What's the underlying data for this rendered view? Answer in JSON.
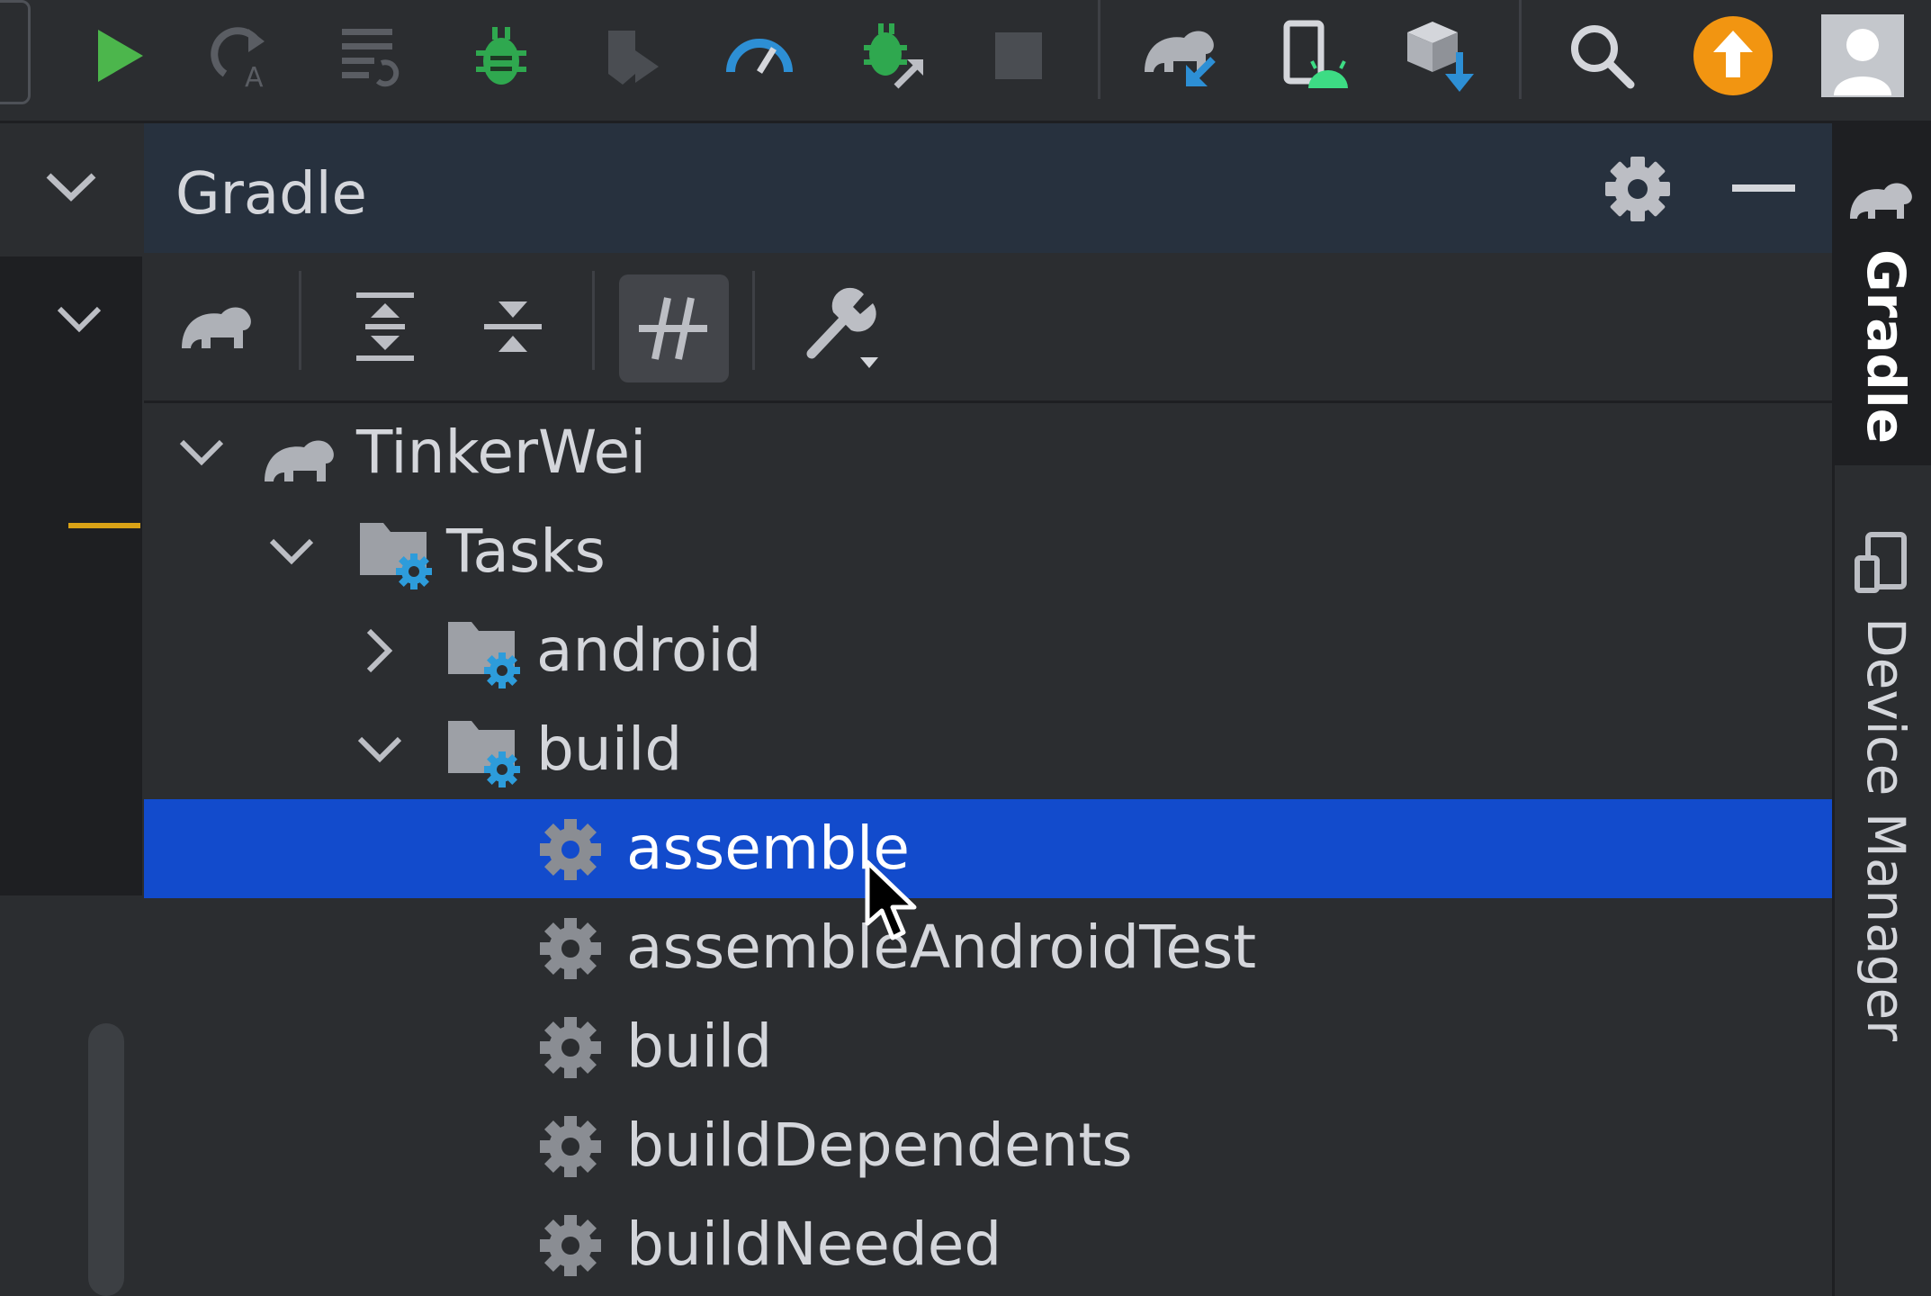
{
  "toolbar": {
    "buttons": [
      {
        "icon": "run-icon"
      },
      {
        "icon": "apply-changes-icon"
      },
      {
        "icon": "apply-code-changes-icon"
      },
      {
        "icon": "debug-icon"
      },
      {
        "icon": "coverage-icon"
      },
      {
        "icon": "profile-icon"
      },
      {
        "icon": "attach-debugger-icon"
      },
      {
        "icon": "stop-icon"
      },
      {
        "icon": "sync-gradle-icon"
      },
      {
        "icon": "device-manager-icon"
      },
      {
        "icon": "sdk-manager-icon"
      },
      {
        "icon": "search-icon"
      },
      {
        "icon": "update-icon"
      },
      {
        "icon": "avatar-icon"
      }
    ]
  },
  "gradle": {
    "title": "Gradle",
    "toolbar_icons": [
      "refresh-gradle-icon",
      "expand-all-icon",
      "collapse-all-icon",
      "toggle-offline-icon",
      "settings-wrench-icon"
    ]
  },
  "tree": {
    "project": "TinkerWei",
    "tasks": "Tasks",
    "group_android": "android",
    "group_build": "build",
    "items": [
      "assemble",
      "assembleAndroidTest",
      "build",
      "buildDependents",
      "buildNeeded"
    ],
    "selected": "assemble"
  },
  "side_tabs": {
    "gradle": "Gradle",
    "device_manager": "Device Manager"
  },
  "colors": {
    "accent_selection": "#124bcc",
    "run_green": "#4cb64c",
    "update_orange": "#f29511",
    "gear_blue": "#2d9cdb"
  }
}
